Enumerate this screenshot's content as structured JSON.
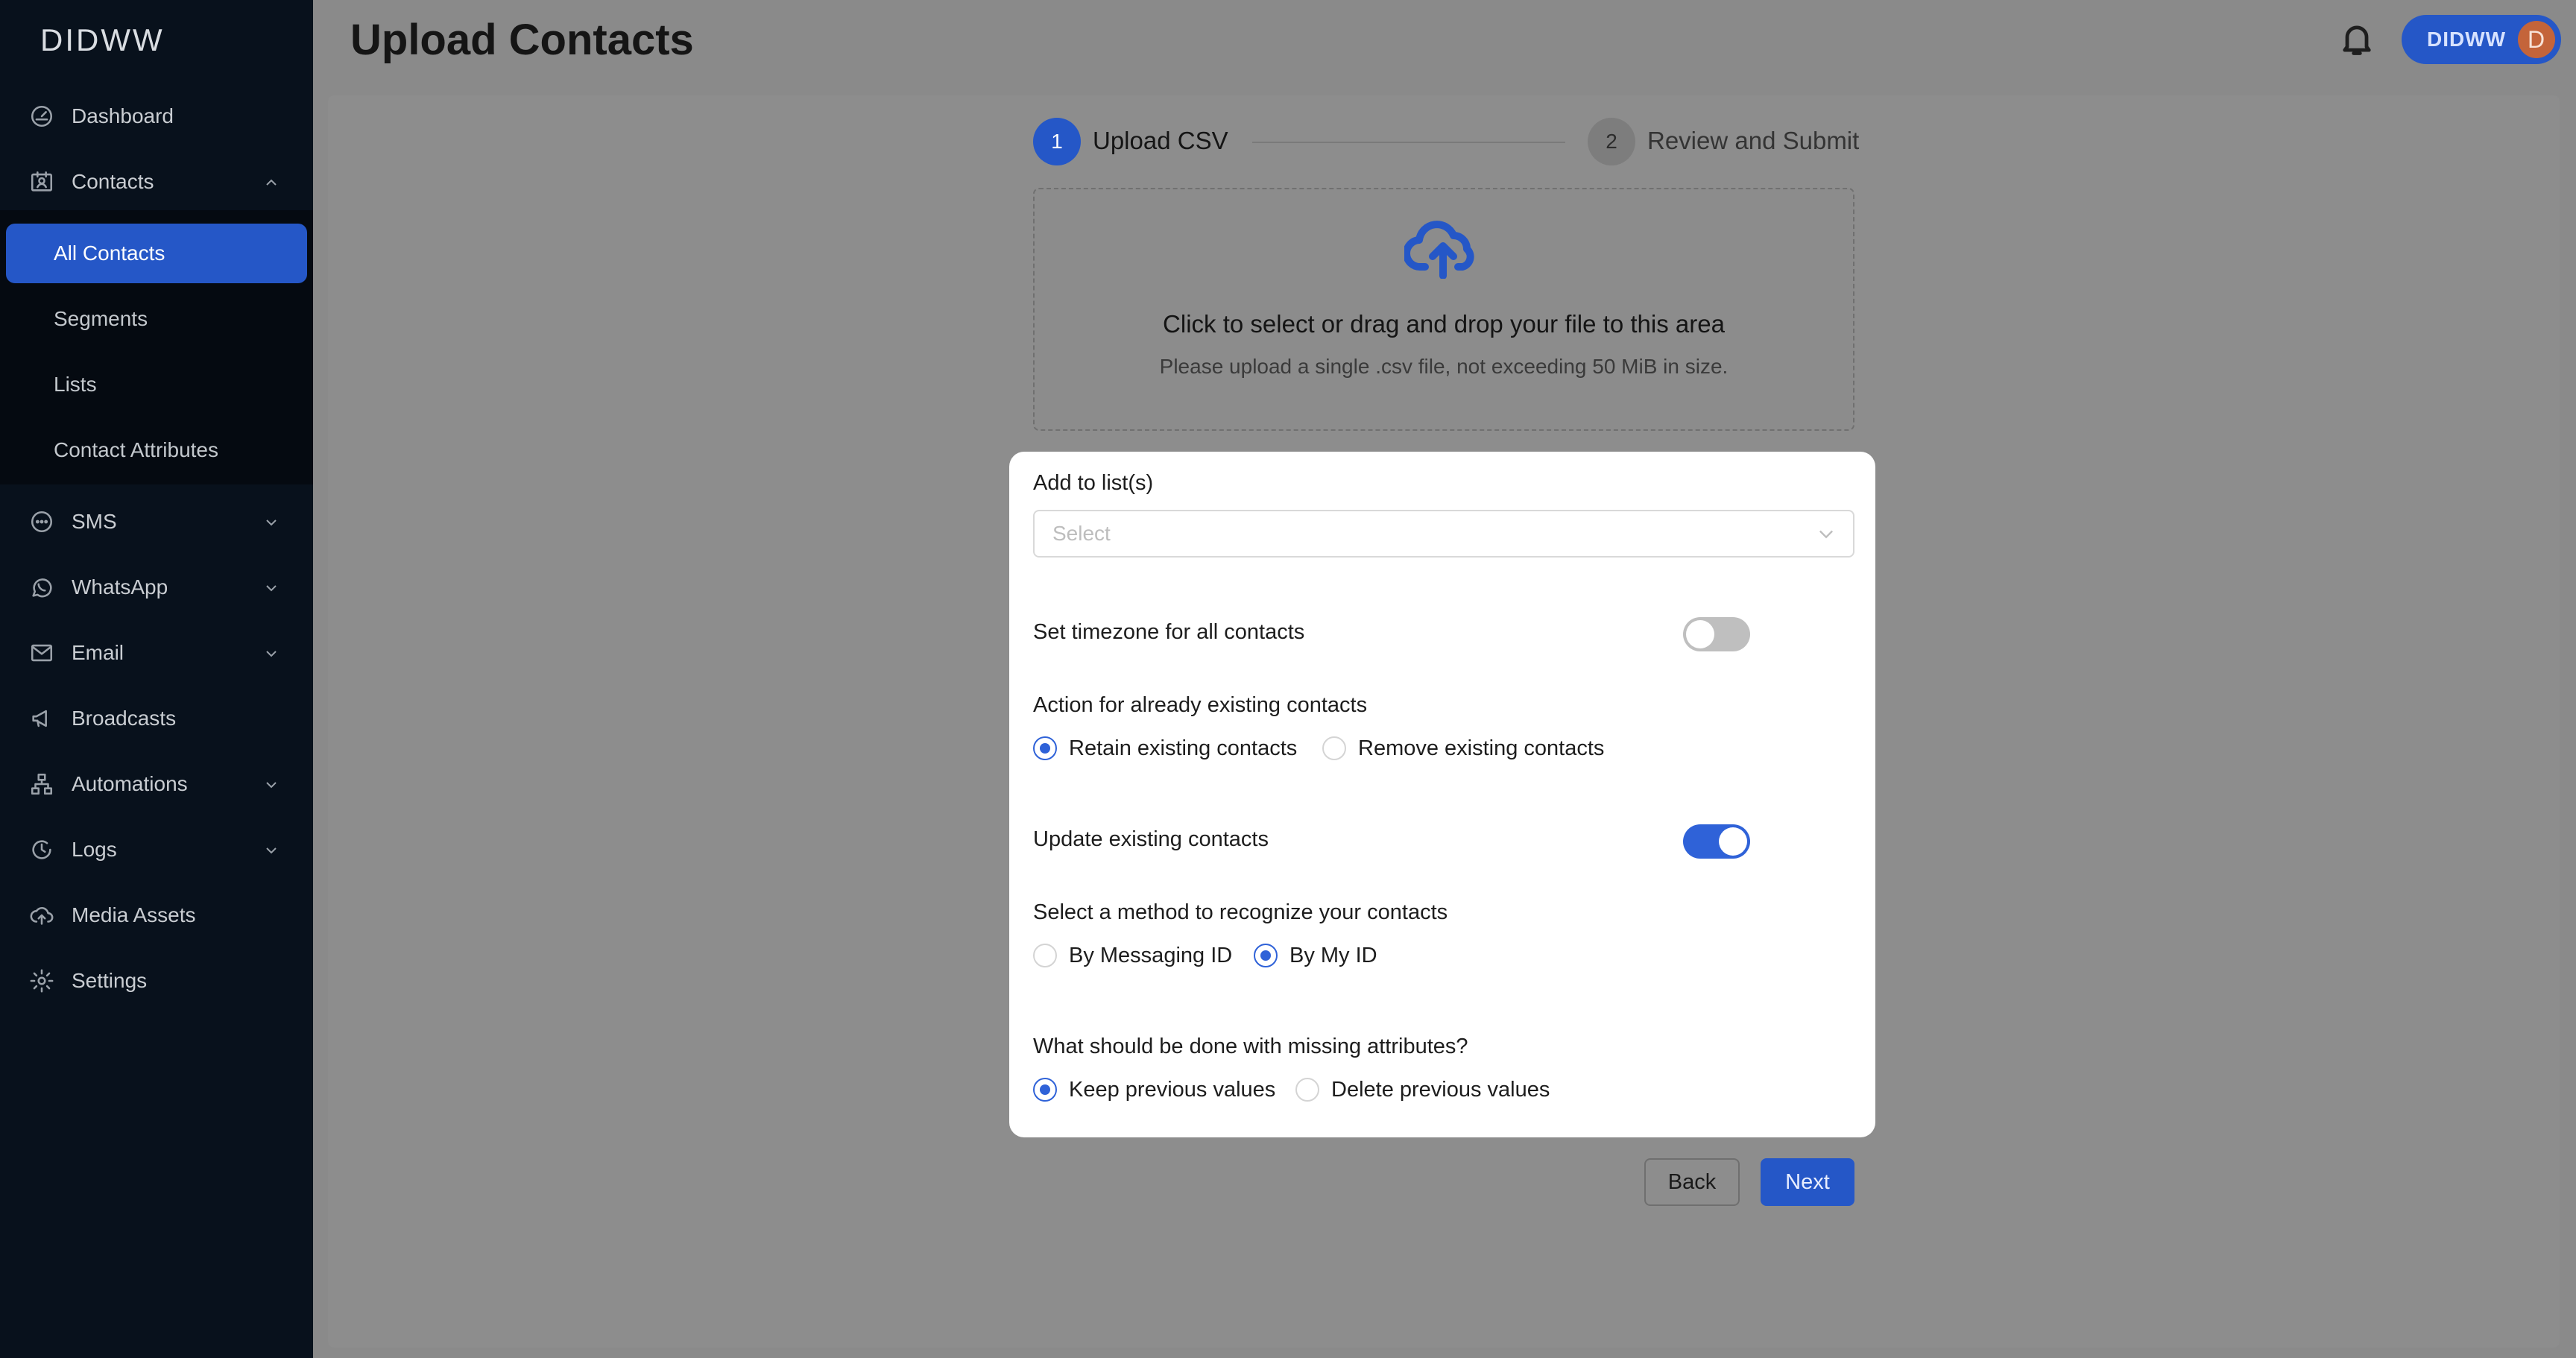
{
  "app": {
    "logo": "DIDWW"
  },
  "sidebar": {
    "items": [
      {
        "label": "Dashboard",
        "icon": "dashboard-icon"
      },
      {
        "label": "Contacts",
        "icon": "contacts-icon",
        "expanded": true
      },
      {
        "label": "SMS",
        "icon": "sms-icon"
      },
      {
        "label": "WhatsApp",
        "icon": "whatsapp-icon"
      },
      {
        "label": "Email",
        "icon": "email-icon"
      },
      {
        "label": "Broadcasts",
        "icon": "broadcast-icon"
      },
      {
        "label": "Automations",
        "icon": "automations-icon"
      },
      {
        "label": "Logs",
        "icon": "logs-icon"
      },
      {
        "label": "Media Assets",
        "icon": "cloud-upload-icon"
      },
      {
        "label": "Settings",
        "icon": "gear-icon"
      }
    ],
    "contacts_sub": [
      {
        "label": "All Contacts",
        "active": true
      },
      {
        "label": "Segments"
      },
      {
        "label": "Lists"
      },
      {
        "label": "Contact Attributes"
      }
    ]
  },
  "header": {
    "title": "Upload Contacts",
    "user_label": "DIDWW",
    "avatar_initial": "D"
  },
  "steps": [
    {
      "number": "1",
      "label": "Upload CSV",
      "active": true
    },
    {
      "number": "2",
      "label": "Review and Submit",
      "active": false
    }
  ],
  "dropzone": {
    "title": "Click to select or drag and drop your file to this area",
    "subtitle": "Please upload a single .csv file, not exceeding 50 MiB in size."
  },
  "form": {
    "add_to_list_label": "Add to list(s)",
    "add_to_list_placeholder": "Select",
    "timezone_label": "Set timezone for all contacts",
    "timezone_enabled": false,
    "existing_action_label": "Action for already existing contacts",
    "existing_action_options": [
      "Retain existing contacts",
      "Remove existing contacts"
    ],
    "existing_action_selected": "Retain existing contacts",
    "update_existing_label": "Update existing contacts",
    "update_existing_enabled": true,
    "method_label": "Select a method to recognize your contacts",
    "method_options": [
      "By Messaging ID",
      "By My ID"
    ],
    "method_selected": "By My ID",
    "missing_label": "What should be done with missing attributes?",
    "missing_options": [
      "Keep previous values",
      "Delete previous values"
    ],
    "missing_selected": "Keep previous values"
  },
  "buttons": {
    "back": "Back",
    "next": "Next"
  },
  "colors": {
    "accent": "#2557c7",
    "sidebar_bg": "#08111c",
    "overlay": "#8a8a8a"
  }
}
